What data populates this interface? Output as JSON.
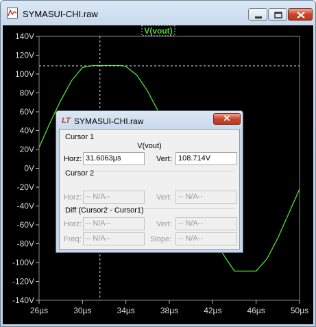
{
  "window": {
    "title": "SYMASUI-CHI.raw"
  },
  "plot": {
    "trace_label": "V(vout)",
    "trace_color": "#4cd62f",
    "background": "#000000",
    "y_ticks": [
      "140V",
      "120V",
      "100V",
      "80V",
      "60V",
      "40V",
      "20V",
      "0V",
      "-20V",
      "-40V",
      "-60V",
      "-80V",
      "-100V",
      "-120V",
      "-140V"
    ],
    "x_ticks": [
      "26µs",
      "30µs",
      "34µs",
      "38µs",
      "42µs",
      "46µs",
      "50µs"
    ]
  },
  "chart_data": {
    "type": "line",
    "title": "V(vout)",
    "xlabel": "",
    "ylabel": "",
    "x_unit": "µs",
    "y_unit": "V",
    "xlim": [
      26,
      50
    ],
    "ylim": [
      -140,
      140
    ],
    "grid": false,
    "series": [
      {
        "name": "V(vout)",
        "color": "#4cd62f",
        "x": [
          26.0,
          27.0,
          28.0,
          29.0,
          30.0,
          31.0,
          31.6,
          32.0,
          33.0,
          33.6,
          34.0,
          35.0,
          36.0,
          37.0,
          38.0,
          39.0,
          40.0,
          41.0,
          42.0,
          43.0,
          44.0,
          45.0,
          46.0,
          47.0,
          48.0,
          49.0,
          50.0
        ],
        "y": [
          22,
          48,
          72,
          93,
          107,
          109,
          109,
          109,
          109,
          109,
          108,
          99,
          82,
          60,
          35,
          7,
          -20,
          -46,
          -70,
          -92,
          -109,
          -109,
          -109,
          -96,
          -74,
          -48,
          -22
        ]
      }
    ],
    "cursor": {
      "x": 31.6063,
      "y": 108.714
    }
  },
  "dialog": {
    "title": "SYMASUI-CHI.raw",
    "close_label": "✕",
    "cursor1": {
      "group": "Cursor 1",
      "trace": "V(vout)",
      "horz_label": "Horz:",
      "horz": "31.6063µs",
      "vert_label": "Vert:",
      "vert": "108.714V"
    },
    "cursor2": {
      "group": "Cursor 2",
      "horz_label": "Horz:",
      "horz": "-- N/A--",
      "vert_label": "Vert:",
      "vert": "-- N/A--"
    },
    "diff": {
      "group": "Diff (Cursor2 - Cursor1)",
      "horz_label": "Horz:",
      "horz": "-- N/A--",
      "vert_label": "Vert:",
      "vert": "-- N/A--",
      "freq_label": "Freq:",
      "freq": "-- N/A--",
      "slope_label": "Slope:",
      "slope": "-- N/A--"
    }
  }
}
